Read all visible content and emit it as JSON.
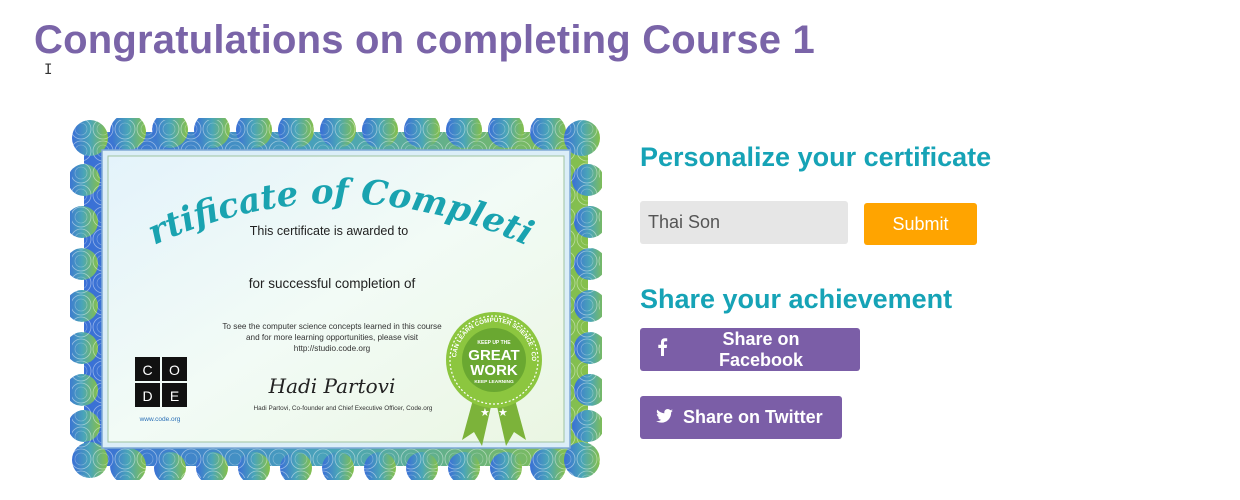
{
  "page": {
    "title": "Congratulations on completing Course 1"
  },
  "certificate": {
    "heading": "Certificate of Completion",
    "awarded_to": "This certificate is awarded to",
    "completion_of": "for successful completion of",
    "info_line1": "To see the computer science concepts learned in this course",
    "info_line2": "and for more learning opportunities, please visit",
    "info_url": "http://studio.code.org",
    "signature": "Hadi Partovi",
    "signer": "Hadi Partovi, Co-founder and Chief Executive Officer, Code.org",
    "logo_letters": [
      "C",
      "O",
      "D",
      "E"
    ],
    "logo_url": "www.code.org",
    "seal_top": "KEEP UP THE",
    "seal_ring": "ANYONE CAN LEARN COMPUTER SCIENCE · CODE.ORG",
    "seal_main1": "GREAT",
    "seal_main2": "WORK",
    "seal_bottom": "KEEP LEARNING"
  },
  "personalize": {
    "title": "Personalize your certificate",
    "name_value": "Thai Son",
    "submit_label": "Submit"
  },
  "share": {
    "title": "Share your achievement",
    "facebook_label": "Share on Facebook",
    "twitter_label": "Share on Twitter"
  },
  "colors": {
    "title_purple": "#7a64a8",
    "section_teal": "#16a3b6",
    "submit_orange": "#ffa400",
    "share_purple": "#7b5ea7",
    "cert_heading_teal": "#1aa3b0"
  }
}
